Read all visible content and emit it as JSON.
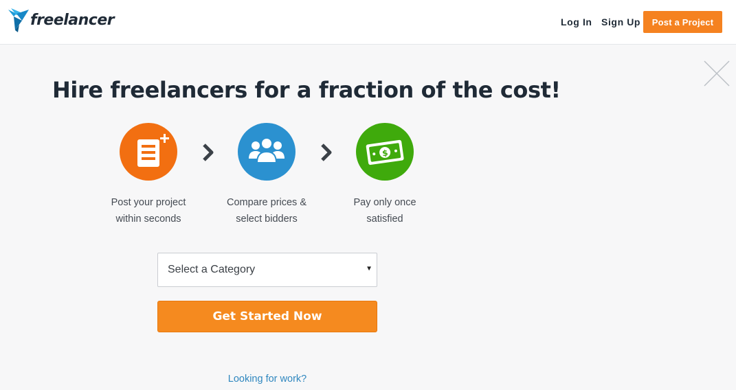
{
  "header": {
    "logo_text": "freelancer",
    "logo_icon": "bird-logo-icon",
    "login_label": "Log In",
    "signup_label": "Sign Up",
    "post_project_label": "Post a Project"
  },
  "main": {
    "headline": "Hire freelancers for a fraction of the cost!",
    "close_icon": "close-icon",
    "steps": [
      {
        "icon": "document-plus-icon",
        "color": "#f26f11",
        "line1": "Post your project",
        "line2": "within seconds"
      },
      {
        "icon": "users-group-icon",
        "color": "#2b91d0",
        "line1": "Compare prices &",
        "line2": "select bidders"
      },
      {
        "icon": "cash-bill-icon",
        "color": "#3faa0c",
        "line1": "Pay only once",
        "line2": "satisfied"
      }
    ],
    "category_select": {
      "selected": "Select a Category"
    },
    "get_started_label": "Get Started Now",
    "looking_for_work_label": "Looking for work?"
  },
  "colors": {
    "accent": "#f58220",
    "link": "#2f87bf",
    "text": "#1f2a36",
    "background": "#f7f7f8"
  }
}
